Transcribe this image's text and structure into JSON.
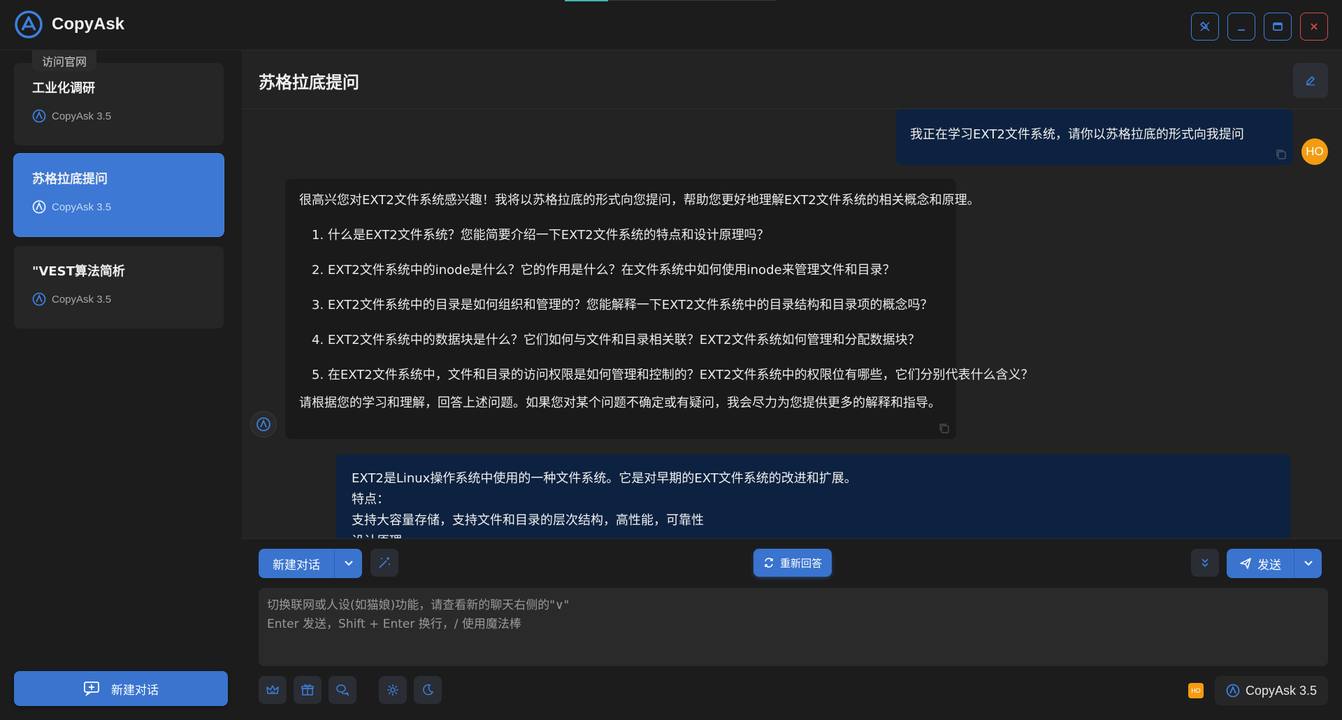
{
  "app": {
    "name": "CopyAsk",
    "visit_site": "访问官网"
  },
  "window_controls": [
    "pin",
    "minimize",
    "maximize",
    "close"
  ],
  "sidebar": {
    "chats": [
      {
        "title": "工业化调研",
        "model": "CopyAsk 3.5",
        "active": false
      },
      {
        "title": "苏格拉底提问",
        "model": "CopyAsk 3.5",
        "active": true
      },
      {
        "title": "\"VEST算法简析",
        "model": "CopyAsk 3.5",
        "active": false
      }
    ],
    "new_chat_label": "新建对话"
  },
  "main": {
    "title": "苏格拉底提问",
    "messages": {
      "user_message": "我正在学习EXT2文件系统，请你以苏格拉底的形式向我提问",
      "user_avatar": "HO",
      "bot_intro": "很高兴您对EXT2文件系统感兴趣！我将以苏格拉底的形式向您提问，帮助您更好地理解EXT2文件系统的相关概念和原理。",
      "bot_questions": [
        "1. 什么是EXT2文件系统？您能简要介绍一下EXT2文件系统的特点和设计原理吗？",
        "2. EXT2文件系统中的inode是什么？它的作用是什么？在文件系统中如何使用inode来管理文件和目录？",
        "3. EXT2文件系统中的目录是如何组织和管理的？您能解释一下EXT2文件系统中的目录结构和目录项的概念吗？",
        "4. EXT2文件系统中的数据块是什么？它们如何与文件和目录相关联？EXT2文件系统如何管理和分配数据块？",
        "5. 在EXT2文件系统中，文件和目录的访问权限是如何管理和控制的？EXT2文件系统中的权限位有哪些，它们分别代表什么含义？"
      ],
      "bot_outro": "请根据您的学习和理解，回答上述问题。如果您对某个问题不确定或有疑问，我会尽力为您提供更多的解释和指导。",
      "reply_lines": [
        "EXT2是Linux操作系统中使用的一种文件系统。它是对早期的EXT文件系统的改进和扩展。",
        "特点：",
        "支持大容量存储，支持文件和目录的层次结构，高性能，可靠性",
        "设计原理"
      ]
    }
  },
  "composer": {
    "new_chat_label": "新建对话",
    "regenerate_label": "重新回答",
    "send_label": "发送",
    "placeholder_line1": "切换联网或人设(如猫娘)功能，请查看新的聊天右侧的\"∨\"",
    "placeholder_line2": "Enter 发送，Shift + Enter 换行，/ 使用魔法棒",
    "user_badge": "HO",
    "model_label": "CopyAsk 3.5"
  },
  "colors": {
    "accent": "#3a74cf",
    "user_bubble": "#0d2240",
    "avatar_orange": "#f39c12",
    "close_red": "#d84a4a"
  }
}
